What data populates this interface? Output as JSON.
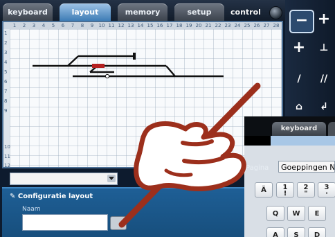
{
  "tabs": [
    "keyboard",
    "layout",
    "memory",
    "setup"
  ],
  "control_label": "control",
  "grid": {
    "columns": [
      "1",
      "2",
      "3",
      "4",
      "5",
      "6",
      "7",
      "8",
      "9",
      "10",
      "11",
      "12",
      "13",
      "14",
      "15",
      "16",
      "17",
      "18",
      "19",
      "20",
      "21",
      "22",
      "23",
      "24",
      "25",
      "26",
      "27",
      "28"
    ],
    "rows": [
      "1",
      "2",
      "3",
      "4",
      "5",
      "6",
      "7",
      "8",
      "9",
      "10",
      "11",
      "12"
    ]
  },
  "tools": [
    "minus-icon",
    "plus-icon",
    "plus-icon",
    "signal-icon",
    "straight-track-icon",
    "double-track-icon",
    "lock-icon",
    "curve-icon"
  ],
  "config": {
    "title": "Configuratie layout",
    "name_label": "Naam",
    "name_value": ""
  },
  "overlay": {
    "tab_label": "keyboard",
    "page_label": "Pagina",
    "page_value": "Goeppingen N",
    "keys_row1": [
      {
        "top": "",
        "bottom": "Ä"
      },
      {
        "top": "1",
        "bottom": "!"
      },
      {
        "top": "2",
        "bottom": "\""
      },
      {
        "top": "3",
        "bottom": "·"
      }
    ],
    "keys_row2": [
      "Q",
      "W",
      "E"
    ],
    "keys_row3": [
      "A",
      "S",
      "D"
    ]
  },
  "colors": {
    "accent": "#3e7db6",
    "panel": "#1e5f96",
    "hand": "#9c2f1c"
  }
}
